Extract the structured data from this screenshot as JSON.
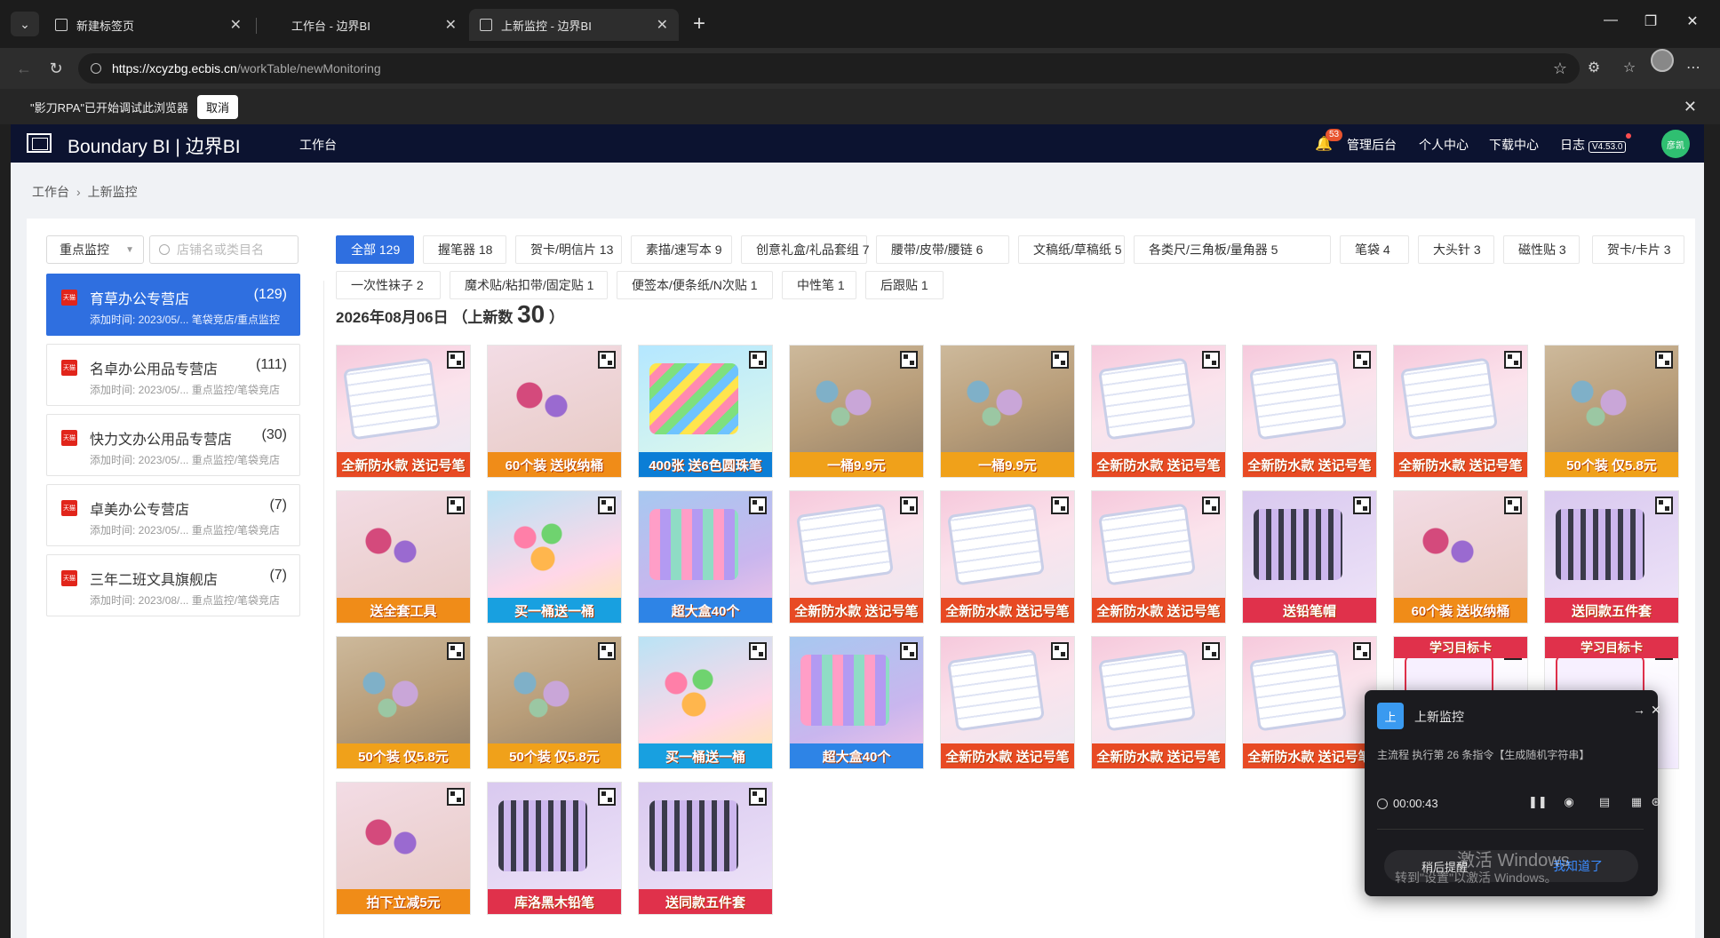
{
  "browser": {
    "tabs": [
      {
        "title": "新建标签页"
      },
      {
        "title": "工作台 - 边界BI"
      },
      {
        "title": "上新监控 - 边界BI"
      }
    ],
    "url_host": "https://xcyzbg.ecbis.cn",
    "url_path": "/workTable/newMonitoring",
    "infobar_text": "\"影刀RPA\"已开始调试此浏览器",
    "infobar_cancel": "取消"
  },
  "header": {
    "brand": "Boundary BI | 边界BI",
    "nav_workbench": "工作台",
    "badge_count": "53",
    "admin": "管理后台",
    "personal": "个人中心",
    "downloads": "下载中心",
    "log": "日志",
    "version": "V4.53.0",
    "user_initials": "彦凯"
  },
  "breadcrumb": {
    "home": "工作台",
    "current": "上新监控"
  },
  "sidebar": {
    "filter_value": "重点监控",
    "search_placeholder": "店铺名或类目名",
    "stores": [
      {
        "name": "育草办公专营店",
        "count": "(129)",
        "meta": "添加时间: 2023/05/... 笔袋竞店/重点监控"
      },
      {
        "name": "名卓办公用品专营店",
        "count": "(111)",
        "meta": "添加时间: 2023/05/... 重点监控/笔袋竞店"
      },
      {
        "name": "快力文办公用品专营店",
        "count": "(30)",
        "meta": "添加时间: 2023/05/... 重点监控/笔袋竞店"
      },
      {
        "name": "卓美办公专营店",
        "count": "(7)",
        "meta": "添加时间: 2023/05/... 重点监控/笔袋竞店"
      },
      {
        "name": "三年二班文具旗舰店",
        "count": "(7)",
        "meta": "添加时间: 2023/08/... 重点监控/笔袋竞店"
      }
    ],
    "tmall_tag": "天猫"
  },
  "categories": [
    "全部 129",
    "握笔器 18",
    "贺卡/明信片 13",
    "素描/速写本 9",
    "创意礼盒/礼品套组 7",
    "腰带/皮带/腰链 6",
    "文稿纸/草稿纸 5",
    "各类尺/三角板/量角器 5",
    "笔袋 4",
    "大头针 3",
    "磁性贴 3",
    "贺卡/卡片 3",
    "一次性袜子 2",
    "魔术贴/粘扣带/固定贴 1",
    "便签本/便条纸/N次贴 1",
    "中性笔 1",
    "后跟贴 1"
  ],
  "date_section": {
    "date": "2026年08月06日",
    "prefix": "（上新数",
    "count": "30",
    "suffix": "）"
  },
  "products": [
    {
      "style": "label",
      "caption": "全新防水款 送记号笔"
    },
    {
      "style": "bfly2",
      "caption": "60个装 送收纳桶"
    },
    {
      "style": "high",
      "caption": "400张 送6色圆珠笔"
    },
    {
      "style": "bfly",
      "caption": "一桶9.9元"
    },
    {
      "style": "bfly",
      "caption": "一桶9.9元"
    },
    {
      "style": "label",
      "caption": "全新防水款 送记号笔"
    },
    {
      "style": "label",
      "caption": "全新防水款 送记号笔"
    },
    {
      "style": "label",
      "caption": "全新防水款 送记号笔"
    },
    {
      "style": "bfly",
      "caption": "50个装 仅5.8元"
    },
    {
      "style": "bfly2",
      "caption": "送全套工具"
    },
    {
      "style": "bucket",
      "caption": "买一桶送一桶"
    },
    {
      "style": "erase",
      "caption": "超大盒40个"
    },
    {
      "style": "label",
      "caption": "全新防水款 送记号笔"
    },
    {
      "style": "label",
      "caption": "全新防水款 送记号笔"
    },
    {
      "style": "label",
      "caption": "全新防水款 送记号笔"
    },
    {
      "style": "pencil",
      "caption": "送铅笔帽"
    },
    {
      "style": "bfly2",
      "caption": "60个装 送收纳桶"
    },
    {
      "style": "pencil",
      "caption": "送同款五件套"
    },
    {
      "style": "bfly",
      "caption": "50个装 仅5.8元"
    },
    {
      "style": "bfly",
      "caption": "50个装 仅5.8元"
    },
    {
      "style": "bucket",
      "caption": "买一桶送一桶"
    },
    {
      "style": "erase",
      "caption": "超大盒40个"
    },
    {
      "style": "label",
      "caption": "全新防水款 送记号笔"
    },
    {
      "style": "label",
      "caption": "全新防水款 送记号笔"
    },
    {
      "style": "label",
      "caption": "全新防水款 送记号笔"
    },
    {
      "style": "goal",
      "caption": "学习目标卡"
    },
    {
      "style": "goal",
      "caption": "学习目标卡"
    },
    {
      "style": "bfly2",
      "caption": "拍下立减5元"
    },
    {
      "style": "pencil",
      "caption": "库洛黑木铅笔"
    },
    {
      "style": "pencil",
      "caption": "送同款五件套"
    }
  ],
  "rpa_panel": {
    "title": "上新监控",
    "icon_text": "上",
    "message": "主流程 执行第 26 条指令【生成随机字符串】",
    "timer": "00:00:43",
    "later": "稍后提醒",
    "ok": "我知道了"
  },
  "os_watermark": {
    "line1": "激活 Windows",
    "line2": "转到\"设置\"以激活 Windows。"
  }
}
